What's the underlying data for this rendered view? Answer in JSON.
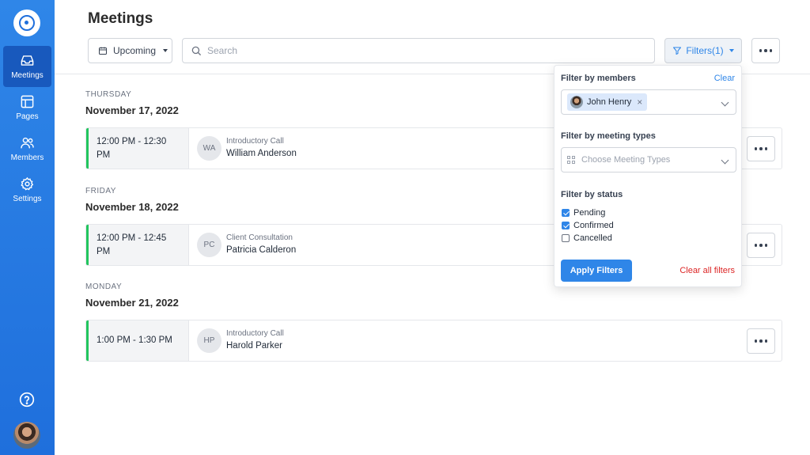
{
  "sidebar": {
    "items": [
      {
        "label": "Meetings",
        "icon": "inbox-icon",
        "active": true
      },
      {
        "label": "Pages",
        "icon": "layout-icon",
        "active": false
      },
      {
        "label": "Members",
        "icon": "users-icon",
        "active": false
      },
      {
        "label": "Settings",
        "icon": "gear-icon",
        "active": false
      }
    ],
    "help_icon": "help-circle-icon"
  },
  "header": {
    "title": "Meetings",
    "view_select": "Upcoming",
    "search_placeholder": "Search",
    "filters_label": "Filters(1)"
  },
  "days": [
    {
      "weekday": "THURSDAY",
      "date": "November 17, 2022",
      "meeting": {
        "time": "12:00 PM - 12:30 PM",
        "initials": "WA",
        "type": "Introductory Call",
        "name": "William Anderson"
      }
    },
    {
      "weekday": "FRIDAY",
      "date": "November 18, 2022",
      "meeting": {
        "time": "12:00 PM - 12:45 PM",
        "initials": "PC",
        "type": "Client Consultation",
        "name": "Patricia Calderon"
      }
    },
    {
      "weekday": "MONDAY",
      "date": "November 21, 2022",
      "meeting": {
        "time": "1:00 PM - 1:30 PM",
        "initials": "HP",
        "type": "Introductory Call",
        "name": "Harold Parker"
      }
    }
  ],
  "filter_panel": {
    "members_heading": "Filter by members",
    "clear_label": "Clear",
    "selected_member": "John Henry",
    "types_heading": "Filter by meeting types",
    "types_placeholder": "Choose Meeting Types",
    "status_heading": "Filter by status",
    "statuses": [
      {
        "label": "Pending",
        "checked": true
      },
      {
        "label": "Confirmed",
        "checked": true
      },
      {
        "label": "Cancelled",
        "checked": false
      }
    ],
    "apply_label": "Apply Filters",
    "clear_all_label": "Clear all filters"
  },
  "colors": {
    "brand": "#2f86e8",
    "status_accent": "#22c55e",
    "danger": "#dc2626"
  }
}
